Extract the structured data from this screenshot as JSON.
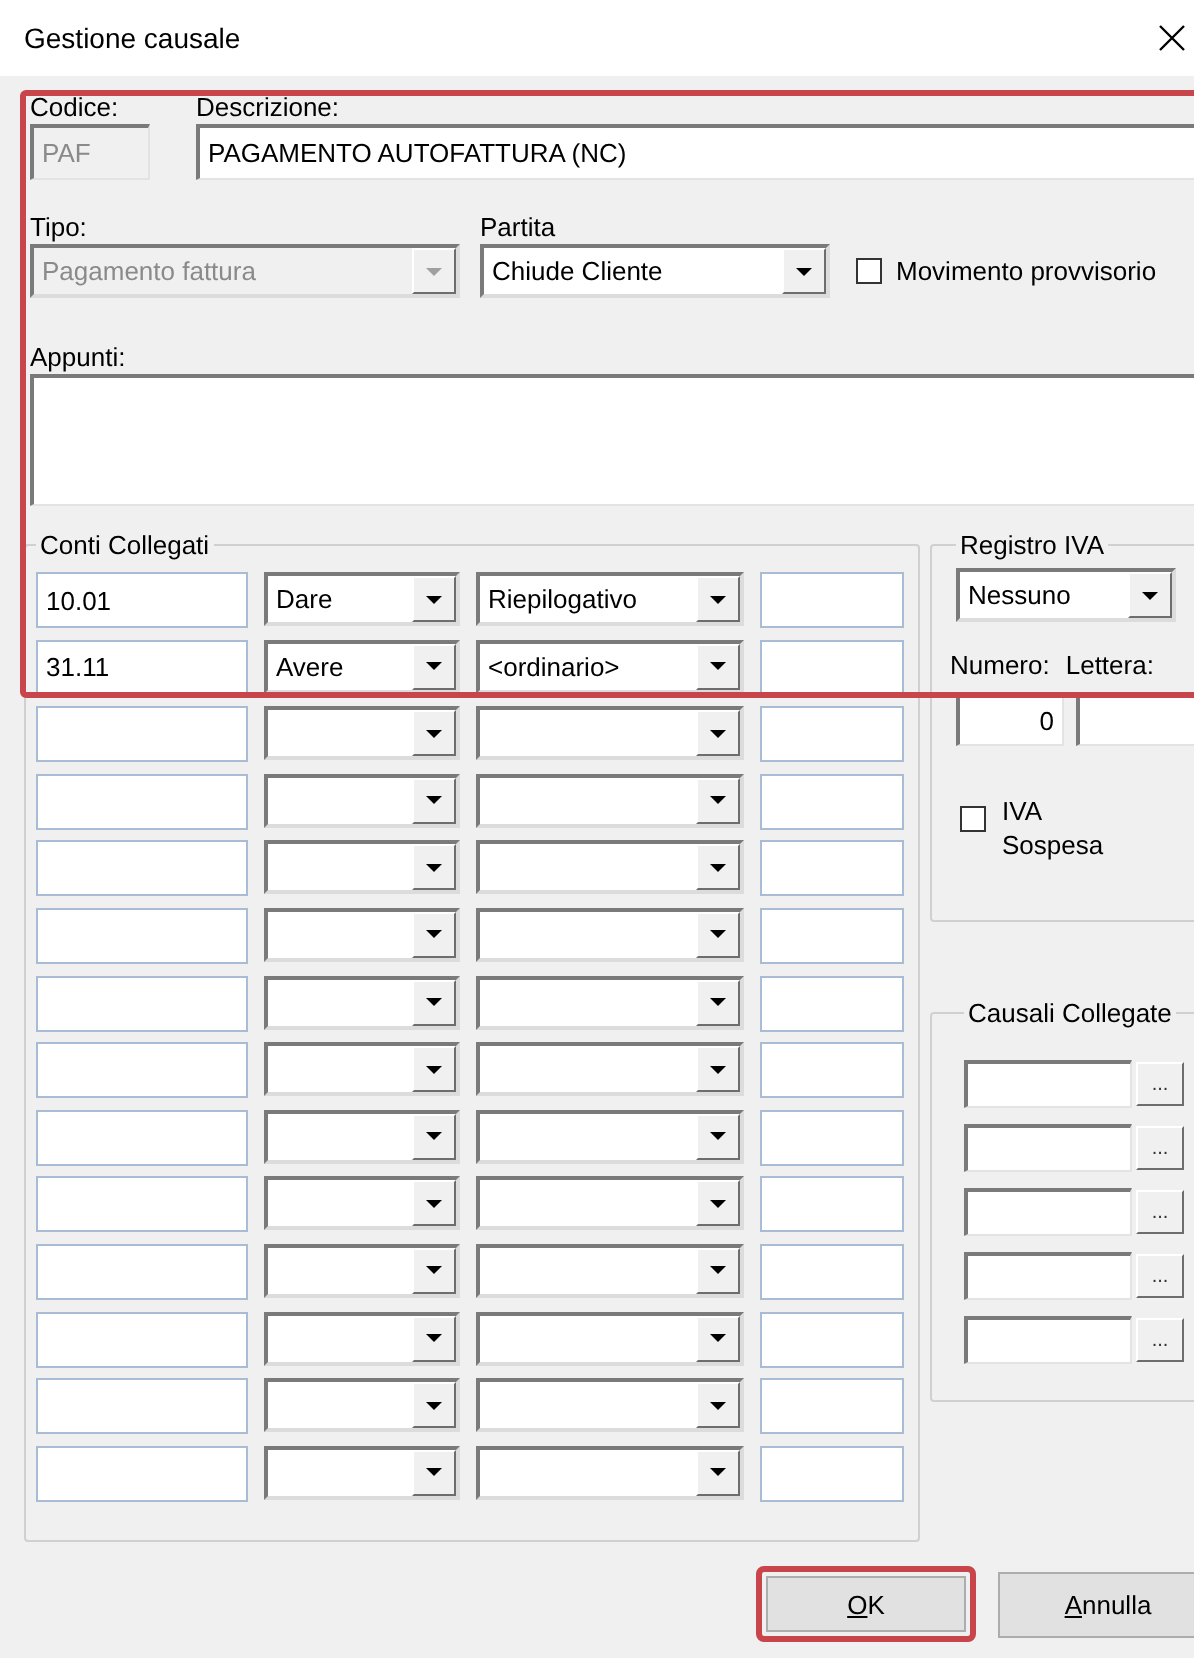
{
  "window": {
    "title": "Gestione causale"
  },
  "codice": {
    "label": "Codice:",
    "value": "PAF",
    "disabled": true
  },
  "descrizione": {
    "label": "Descrizione:",
    "value": "PAGAMENTO AUTOFATTURA (NC)"
  },
  "tipo": {
    "label": "Tipo:",
    "value": "Pagamento fattura",
    "disabled": true
  },
  "partita": {
    "label": "Partita",
    "value": "Chiude Cliente"
  },
  "movimento_provvisorio": {
    "label": "Movimento provvisorio",
    "checked": false
  },
  "appunti": {
    "label": "Appunti:"
  },
  "conti_collegati": {
    "title": "Conti Collegati",
    "rows": [
      {
        "conto": "10.01",
        "segno": "Dare",
        "tipo": "Riepilogativo"
      },
      {
        "conto": "31.11",
        "segno": "Avere",
        "tipo": "<ordinario>"
      },
      {},
      {},
      {},
      {},
      {},
      {},
      {},
      {},
      {},
      {},
      {},
      {}
    ]
  },
  "registro_iva": {
    "title": "Registro IVA",
    "value": "Nessuno",
    "numero_label": "Numero:",
    "lettera_label": "Lettera:",
    "numero": "0"
  },
  "iva_sospesa": {
    "label": "IVA Sospesa",
    "checked": false
  },
  "causali_collegate": {
    "title": "Causali Collegate",
    "rows": [
      {
        "button": "..."
      },
      {
        "button": "..."
      },
      {
        "button": "..."
      },
      {
        "button": "..."
      },
      {
        "button": "..."
      }
    ]
  },
  "buttons": [
    {
      "label": "OK",
      "highlighted": true
    },
    {
      "label": "Annulla",
      "highlighted": false
    }
  ]
}
